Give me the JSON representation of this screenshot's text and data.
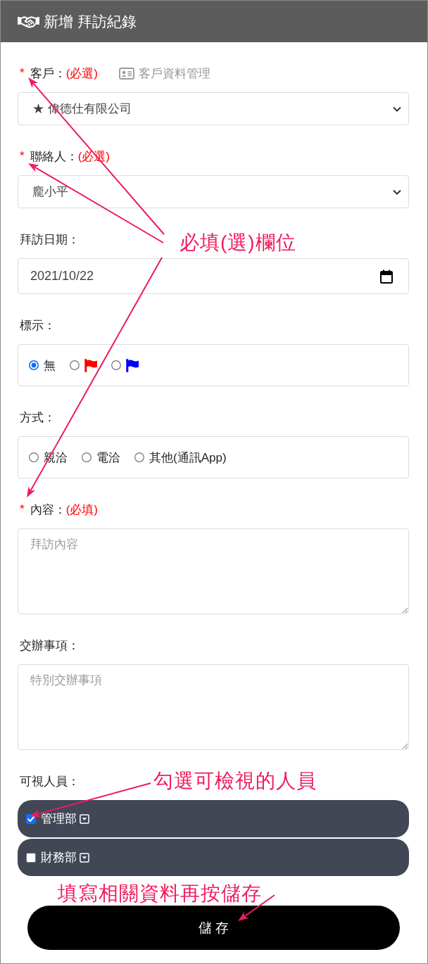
{
  "header": {
    "title": "新增 拜訪紀錄"
  },
  "fields": [
    {
      "kind": "select",
      "required_mark": "*",
      "label": "客戶：",
      "hint": "(必選)",
      "link": "客戶資料管理",
      "value": "★ 偉德仕有限公司"
    },
    {
      "kind": "select",
      "required_mark": "*",
      "label": "聯絡人：",
      "hint": "(必選)",
      "value": "龐小平"
    },
    {
      "kind": "date",
      "label": "拜訪日期：",
      "value": "2021/10/22"
    },
    {
      "kind": "radio",
      "label": "標示：",
      "options": [
        {
          "kind": "text",
          "label": "無",
          "selected": true
        },
        {
          "kind": "flag",
          "color": "#ff0000",
          "selected": false
        },
        {
          "kind": "flag",
          "color": "#0000ff",
          "selected": false
        }
      ]
    },
    {
      "kind": "radio",
      "label": "方式：",
      "options": [
        {
          "kind": "text",
          "label": "親洽",
          "selected": false
        },
        {
          "kind": "text",
          "label": "電洽",
          "selected": false
        },
        {
          "kind": "text",
          "label": "其他(通訊App)",
          "selected": false
        }
      ]
    },
    {
      "kind": "textarea",
      "required_mark": "*",
      "label": "內容：",
      "hint": "(必填)",
      "placeholder": "拜訪內容"
    },
    {
      "kind": "textarea",
      "label": "交辦事項：",
      "placeholder": "特別交辦事項"
    },
    {
      "kind": "checklist",
      "label": "可視人員：",
      "items": [
        {
          "label": "管理部",
          "checked": true
        },
        {
          "label": "財務部",
          "checked": false
        }
      ]
    }
  ],
  "save_button": {
    "label": "儲 存"
  },
  "annotations": [
    {
      "text": "必填(選)欄位"
    },
    {
      "text": "勾選可檢視的人員"
    },
    {
      "text": "填寫相關資料再按儲存"
    }
  ]
}
